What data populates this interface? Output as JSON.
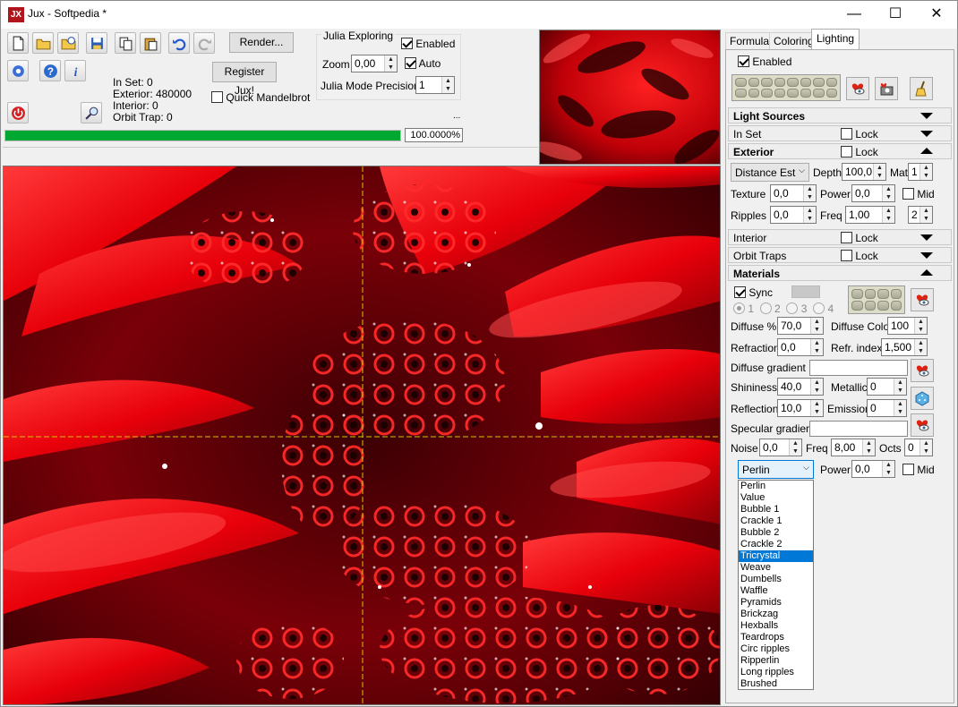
{
  "window": {
    "title": "Jux - Softpedia *",
    "icon_text": "JX",
    "minimize": "—",
    "maximize": "☐",
    "close": "✕"
  },
  "toolbar": {
    "render_label": "Render...",
    "register_label": "Register Jux!",
    "quick_mandelbrot": "Quick Mandelbrot",
    "quick_mandelbrot_checked": false
  },
  "stats": {
    "in_set": "In Set: 0",
    "exterior": "Exterior: 480000",
    "interior": "Interior: 0",
    "orbit_trap": "Orbit Trap: 0"
  },
  "julia": {
    "title": "Julia Exploring",
    "enabled_label": "Enabled",
    "enabled": true,
    "zoom_label": "Zoom",
    "zoom_value": "0,00",
    "auto_label": "Auto",
    "auto": true,
    "precision_label": "Julia Mode Precision",
    "precision_value": "1",
    "ellipsis": "..."
  },
  "progress": {
    "fraction": 1.0,
    "text": "100.0000%",
    "color": "#00a832"
  },
  "tabs": [
    {
      "label": "Formula"
    },
    {
      "label": "Coloring"
    },
    {
      "label": "Lighting",
      "active": true
    }
  ],
  "lighting": {
    "enabled_label": "Enabled",
    "enabled": true,
    "light_sources": "Light Sources",
    "in_set": {
      "label": "In Set",
      "lock": "Lock"
    },
    "exterior": {
      "label": "Exterior",
      "lock": "Lock",
      "method": "Distance Est",
      "depth_label": "Depth",
      "depth": "100,0",
      "mat_label": "Mat",
      "mat": "1",
      "texture_label": "Texture",
      "texture": "0,0",
      "power_label": "Power",
      "power": "0,0",
      "mid_label": "Mid",
      "ripples_label": "Ripples",
      "ripples": "0,0",
      "freq_label": "Freq",
      "freq": "1,00",
      "ripples_count": "2"
    },
    "interior": {
      "label": "Interior",
      "lock": "Lock"
    },
    "orbit_traps": {
      "label": "Orbit Traps",
      "lock": "Lock"
    },
    "materials": {
      "label": "Materials",
      "sync_label": "Sync",
      "sync": true,
      "radios": [
        "1",
        "2",
        "3",
        "4"
      ],
      "diffuse_label": "Diffuse %",
      "diffuse": "70,0",
      "diffuse_color_label": "Diffuse Color",
      "diffuse_color": "100",
      "refraction_label": "Refraction",
      "refraction": "0,0",
      "refr_index_label": "Refr. index",
      "refr_index": "1,500",
      "diffuse_gradient_label": "Diffuse gradient",
      "shininess_label": "Shininess",
      "shininess": "40,0",
      "metallic_label": "Metallic",
      "metallic": "0",
      "reflection_label": "Reflection",
      "reflection": "10,0",
      "emission_label": "Emission",
      "emission": "0",
      "specular_gradient_label": "Specular gradient",
      "noise_label": "Noise",
      "noise": "0,0",
      "noise_freq_label": "Freq",
      "noise_freq": "8,00",
      "octs_label": "Octs",
      "octs": "0",
      "noise_type": "Perlin",
      "power_label": "Power",
      "power": "0,0",
      "mid_label": "Mid"
    }
  },
  "noise_options": [
    "Perlin",
    "Value",
    "Bubble 1",
    "Crackle 1",
    "Bubble 2",
    "Crackle 2",
    "Tricrystal",
    "Weave",
    "Dumbells",
    "Waffle",
    "Pyramids",
    "Brickzag",
    "Hexballs",
    "Teardrops",
    "Circ ripples",
    "Ripperlin",
    "Long ripples",
    "Brushed"
  ],
  "noise_selected": "Tricrystal",
  "colors": {
    "fractal_red": "#e8000a",
    "fractal_dark": "#1a0000",
    "crosshair": "#d4c800",
    "accent": "#0078d7"
  }
}
